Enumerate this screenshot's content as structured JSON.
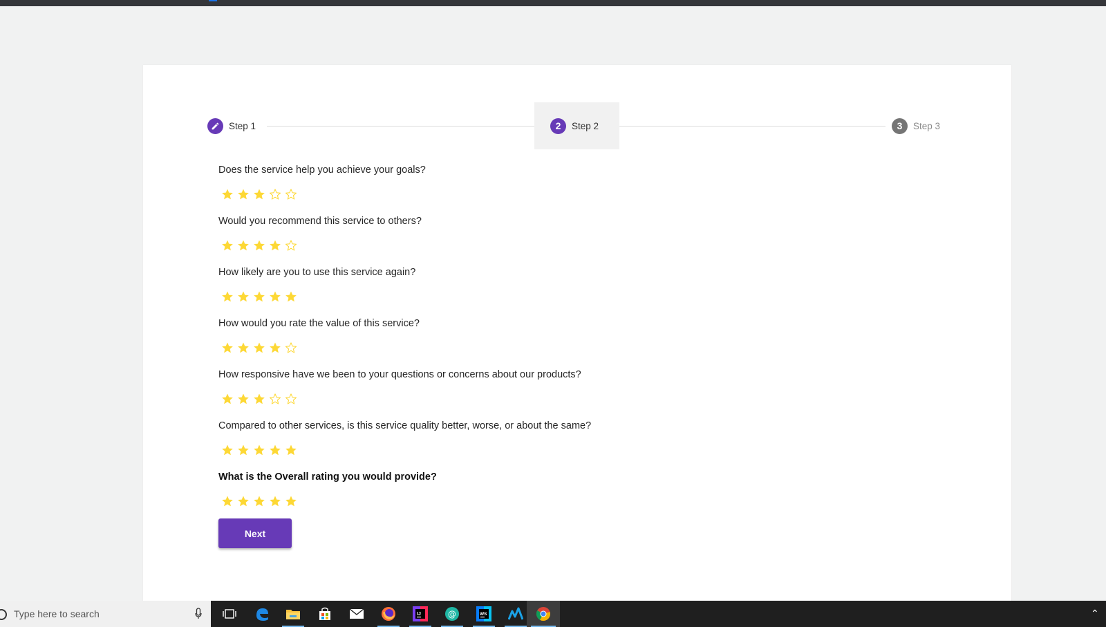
{
  "stepper": {
    "steps": [
      {
        "number": "1",
        "label": "Step 1",
        "state": "completed",
        "icon": "pencil-icon"
      },
      {
        "number": "2",
        "label": "Step 2",
        "state": "active"
      },
      {
        "number": "3",
        "label": "Step 3",
        "state": "pending"
      }
    ]
  },
  "colors": {
    "accent": "#673ab7",
    "star_filled": "#fdd835",
    "star_empty_outline": "#fdd835",
    "pending_step": "#757575"
  },
  "questions": [
    {
      "text": "Does the service help you achieve your goals?",
      "rating": 3,
      "max": 5
    },
    {
      "text": "Would you recommend this service to others?",
      "rating": 4,
      "max": 5
    },
    {
      "text": "How likely are you to use this service again?",
      "rating": 5,
      "max": 5
    },
    {
      "text": "How would you rate the value of this service?",
      "rating": 4,
      "max": 5
    },
    {
      "text": "How responsive have we been to your questions or concerns about our products?",
      "rating": 3,
      "max": 5
    },
    {
      "text": "Compared to other services, is this service quality better, worse, or about the same?",
      "rating": 5,
      "max": 5
    },
    {
      "text": "What is the Overall rating you would provide?",
      "rating": 5,
      "max": 5,
      "bold": true
    }
  ],
  "next_button": {
    "label": "Next"
  },
  "taskbar": {
    "search_placeholder": "Type here to search",
    "apps": [
      {
        "name": "task-view-icon",
        "running": false
      },
      {
        "name": "edge-icon",
        "running": false
      },
      {
        "name": "file-explorer-icon",
        "running": true
      },
      {
        "name": "store-icon",
        "running": false
      },
      {
        "name": "mail-icon",
        "running": false
      },
      {
        "name": "firefox-icon",
        "running": true
      },
      {
        "name": "intellij-icon",
        "running": true
      },
      {
        "name": "at-sign-app-icon",
        "running": true
      },
      {
        "name": "webstorm-icon",
        "running": true
      },
      {
        "name": "analytics-app-icon",
        "running": true
      },
      {
        "name": "chrome-icon",
        "running": true,
        "active": true
      }
    ]
  }
}
